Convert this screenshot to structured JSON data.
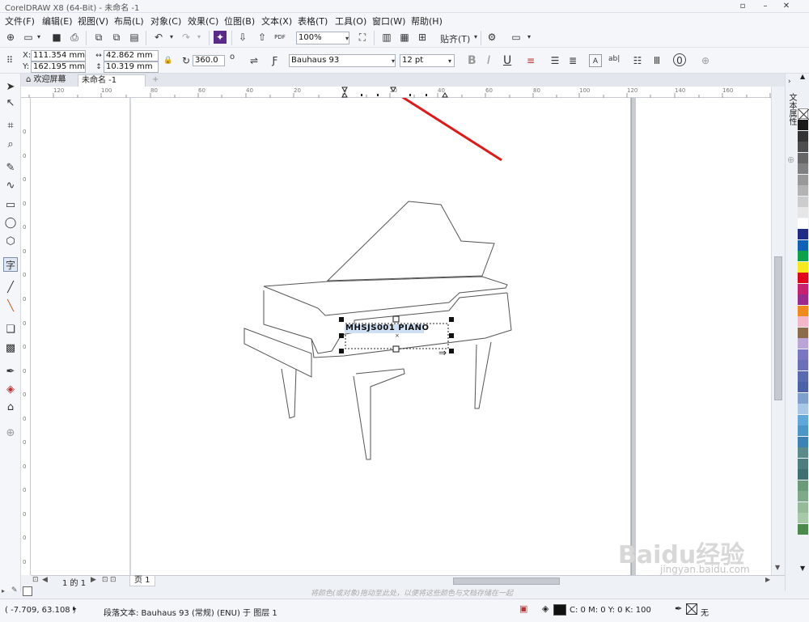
{
  "window": {
    "title": "CorelDRAW X8 (64-Bit) - 未命名 -1"
  },
  "menubar": {
    "items": [
      "文件(F)",
      "编辑(E)",
      "视图(V)",
      "布局(L)",
      "对象(C)",
      "效果(C)",
      "位图(B)",
      "文本(X)",
      "表格(T)",
      "工具(O)",
      "窗口(W)",
      "帮助(H)"
    ]
  },
  "stdbar": {
    "zoom": "100%",
    "snap_label": "贴齐(T)",
    "pdf_label": "PDF"
  },
  "propbar": {
    "x_label": "X:",
    "x_value": "111.354 mm",
    "y_label": "Y:",
    "y_value": "162.195 mm",
    "width_value": "42.862 mm",
    "height_value": "10.319 mm",
    "rotation_value": "360.0",
    "degree_symbol": "o",
    "font_name": "Bauhaus 93",
    "font_size": "12 pt",
    "bold_label": "B",
    "italic_label": "I",
    "underline_label": "U",
    "ab_label": "ab|"
  },
  "tabs": {
    "welcome": "欢迎屏幕",
    "document": "未命名 -1"
  },
  "rulers": {
    "h_ticks": [
      "120",
      "100",
      "80",
      "60",
      "40",
      "20",
      "0",
      "20",
      "40",
      "60",
      "80",
      "100",
      "120",
      "140",
      "160"
    ],
    "v_ticks": [
      "0",
      "0",
      "0",
      "0",
      "0",
      "0",
      "0",
      "0",
      "0",
      "0",
      "0",
      "0",
      "0",
      "0",
      "0",
      "0",
      "0",
      "0",
      "0",
      "0"
    ]
  },
  "canvas": {
    "text_object": "MHSJS001 PIANO"
  },
  "docker": {
    "panel_label": "文本属性"
  },
  "pagenav": {
    "page_of": "1 的 1",
    "page_tab": "页 1"
  },
  "hint": {
    "text": "将颜色(或对象)拖动至此处，以便将这些颜色与文档存储在一起"
  },
  "status": {
    "coordinates": "( -7.709, 63.108 )",
    "object_info": "段落文本: Bauhaus 93 (常规) (ENU) 于 图层 1",
    "fill_info": "C: 0 M: 0 Y: 0 K: 100",
    "outline_info": "无"
  },
  "watermark": {
    "text": "Baidu经验",
    "url": "jingyan.baidu.com"
  },
  "palette": {
    "colors": [
      "#1a1a1a",
      "#333333",
      "#4d4d4d",
      "#666666",
      "#808080",
      "#999999",
      "#b3b3b3",
      "#cccccc",
      "#e6e6e6",
      "#ffffff",
      "#1f2a86",
      "#0f62b5",
      "#0da14b",
      "#f5e81c",
      "#e2001a",
      "#c8206e",
      "#9a2a8c",
      "#f08a1c",
      "#f4b7c7",
      "#8c6a4a",
      "#b9a6d6",
      "#7a76c2",
      "#6b6fb8",
      "#5a6ab0",
      "#4a62a8",
      "#7f9fcf",
      "#a8c7e6",
      "#5fa8d9",
      "#4c95c7",
      "#3e82b5",
      "#5a8a8a",
      "#4d7d7d",
      "#3f6f6f",
      "#6a9a7a",
      "#7faa8a",
      "#94ba9a",
      "#a8c8aa",
      "#4c8a4c"
    ]
  },
  "colors": {
    "accent_red": "#e01818",
    "selection_blue": "#3b78d8"
  }
}
